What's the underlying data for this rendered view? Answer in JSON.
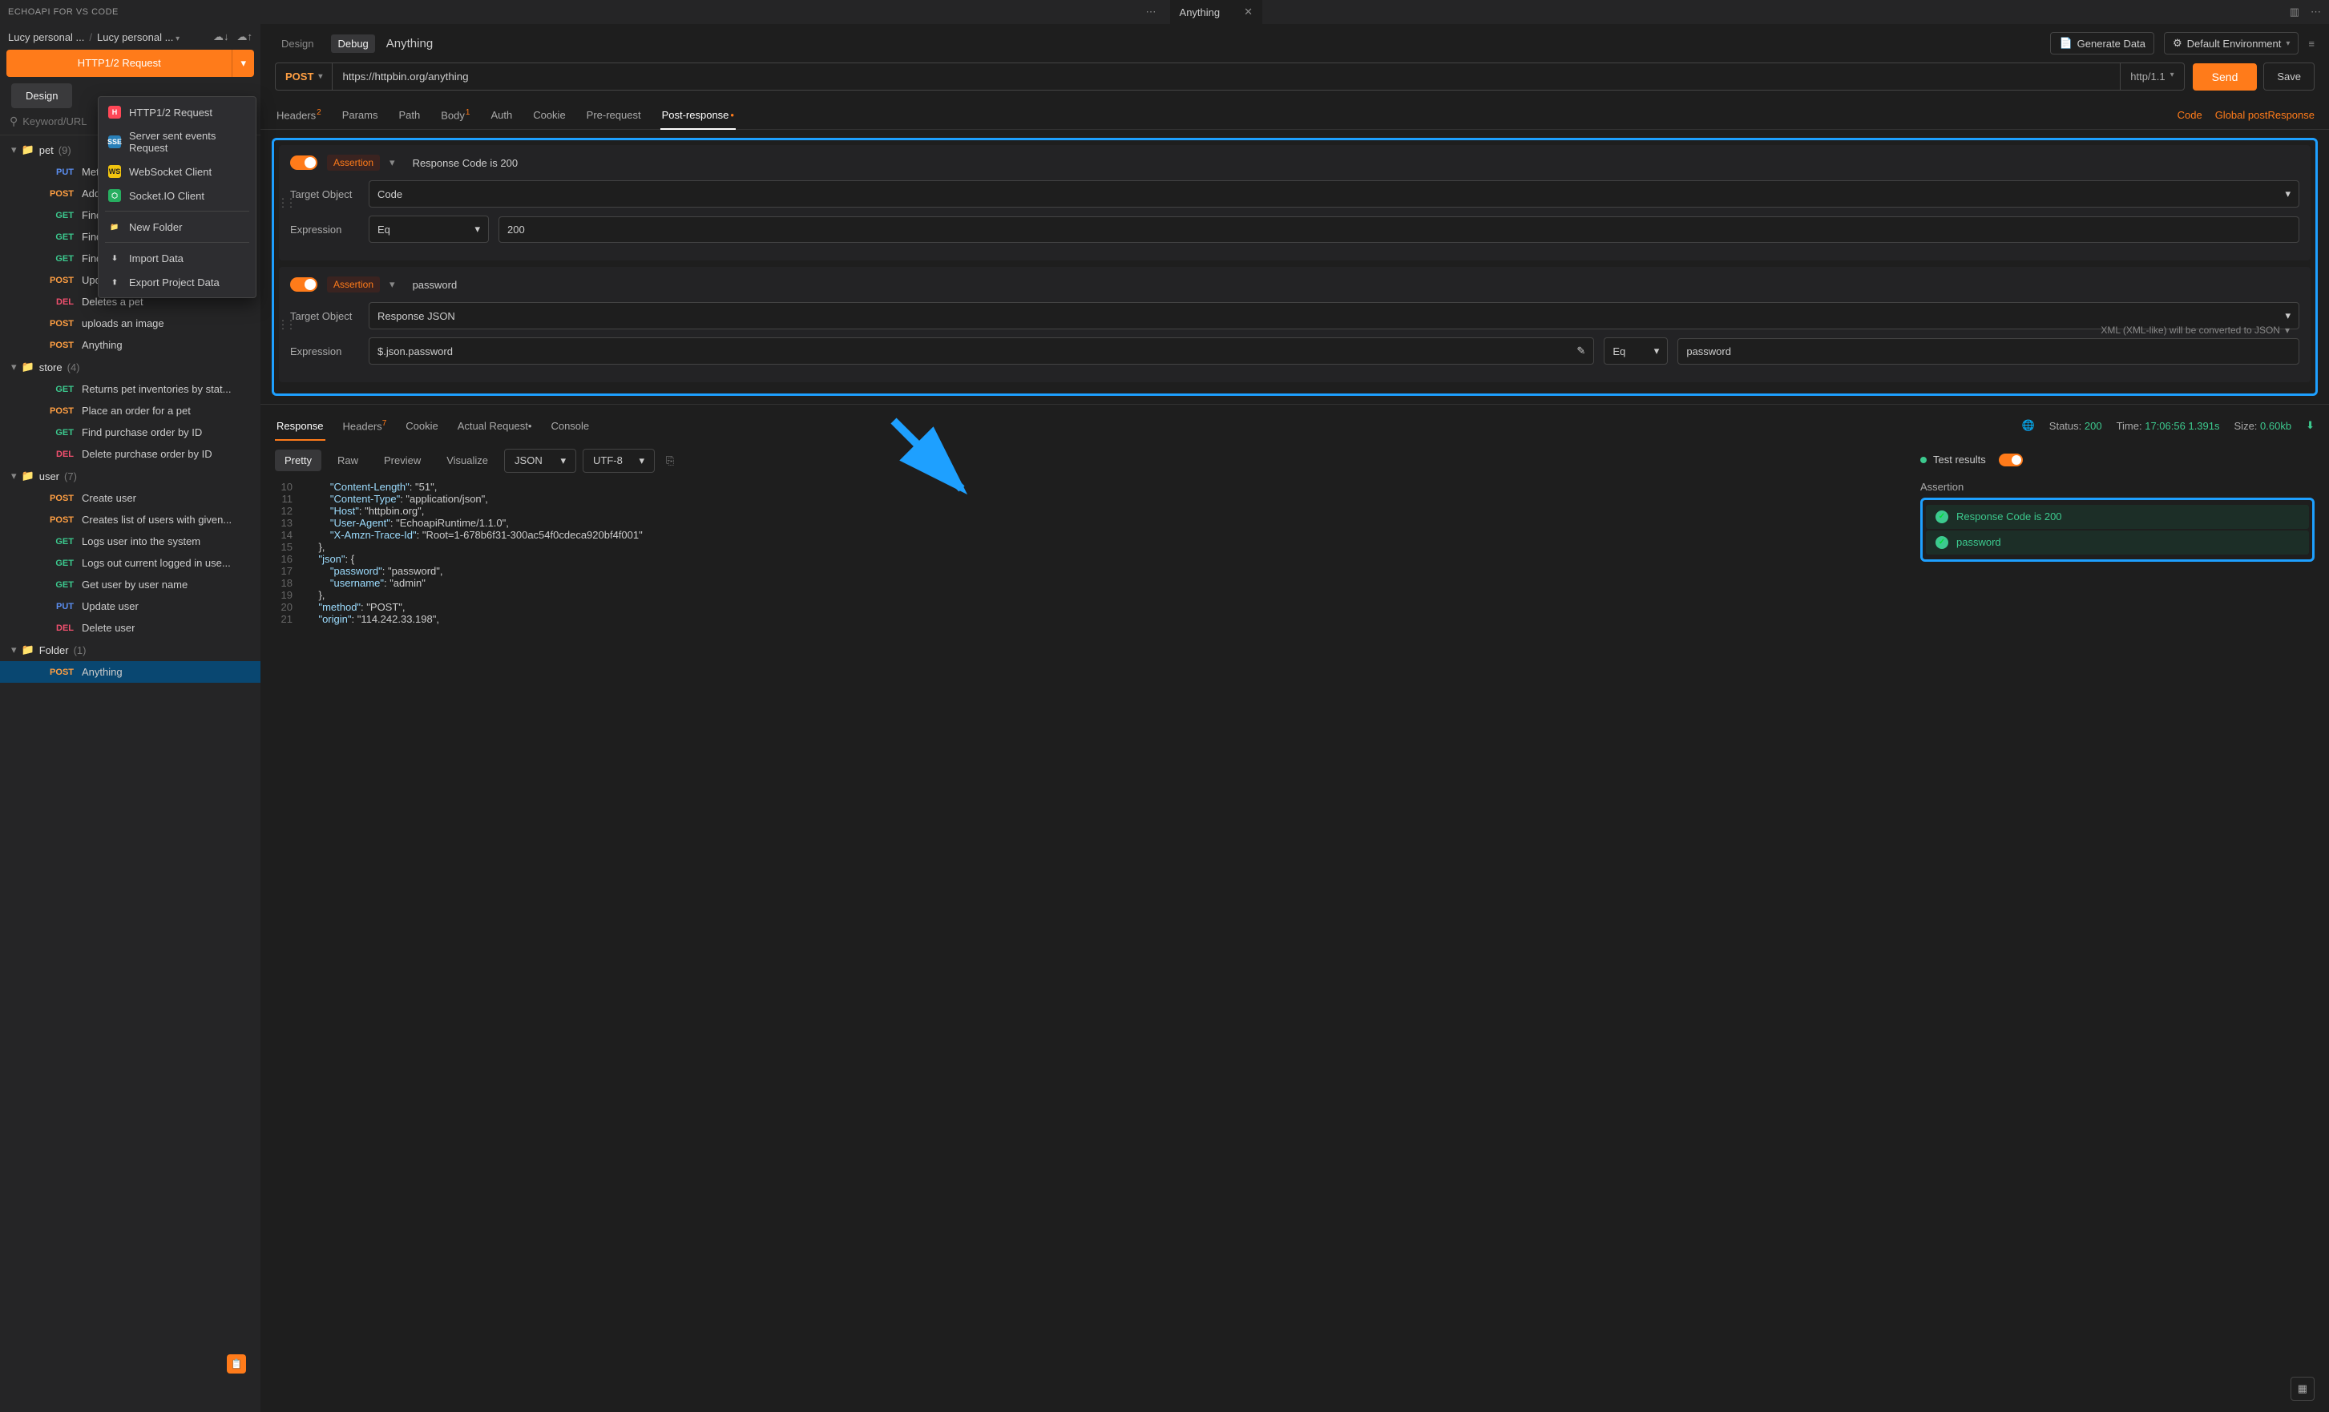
{
  "titlebar": {
    "ext_name": "ECHOAPI FOR VS CODE",
    "tab_title": "Anything"
  },
  "breadcrumb": {
    "crumb1": "Lucy personal ...",
    "crumb2": "Lucy personal ..."
  },
  "new_request_btn": "HTTP1/2 Request",
  "subtabs": {
    "design": "Design"
  },
  "search": {
    "placeholder": "Keyword/URL"
  },
  "dropdown": {
    "http": "HTTP1/2 Request",
    "sse": "Server sent events Request",
    "ws": "WebSocket Client",
    "sio": "Socket.IO Client",
    "newfolder": "New Folder",
    "import": "Import Data",
    "export": "Export Project Data"
  },
  "tree": {
    "pet": {
      "name": "pet",
      "count": "(9)"
    },
    "pet_items": [
      {
        "method": "PUT",
        "label": "Met"
      },
      {
        "method": "POST",
        "label": "Add"
      },
      {
        "method": "GET",
        "label": "Find"
      },
      {
        "method": "GET",
        "label": "Find"
      },
      {
        "method": "GET",
        "label": "Find pet by ID"
      },
      {
        "method": "POST",
        "label": "Updates a pet in the store with..."
      },
      {
        "method": "DEL",
        "label": "Deletes a pet"
      },
      {
        "method": "POST",
        "label": "uploads an image"
      },
      {
        "method": "POST",
        "label": "Anything"
      }
    ],
    "store": {
      "name": "store",
      "count": "(4)"
    },
    "store_items": [
      {
        "method": "GET",
        "label": "Returns pet inventories by stat..."
      },
      {
        "method": "POST",
        "label": "Place an order for a pet"
      },
      {
        "method": "GET",
        "label": "Find purchase order by ID"
      },
      {
        "method": "DEL",
        "label": "Delete purchase order by ID"
      }
    ],
    "user": {
      "name": "user",
      "count": "(7)"
    },
    "user_items": [
      {
        "method": "POST",
        "label": "Create user"
      },
      {
        "method": "POST",
        "label": "Creates list of users with given..."
      },
      {
        "method": "GET",
        "label": "Logs user into the system"
      },
      {
        "method": "GET",
        "label": "Logs out current logged in use..."
      },
      {
        "method": "GET",
        "label": "Get user by user name"
      },
      {
        "method": "PUT",
        "label": "Update user"
      },
      {
        "method": "DEL",
        "label": "Delete user"
      }
    ],
    "folder": {
      "name": "Folder",
      "count": "(1)"
    },
    "folder_items": [
      {
        "method": "POST",
        "label": "Anything"
      }
    ]
  },
  "toprow": {
    "design": "Design",
    "debug": "Debug",
    "name": "Anything",
    "generate": "Generate Data",
    "env": "Default Environment"
  },
  "url": {
    "method": "POST",
    "url": "https://httpbin.org/anything",
    "proto": "http/1.1",
    "send": "Send",
    "save": "Save"
  },
  "reqtabs": {
    "headers": "Headers",
    "headers_n": "2",
    "params": "Params",
    "path": "Path",
    "body": "Body",
    "body_n": "1",
    "auth": "Auth",
    "cookie": "Cookie",
    "prereq": "Pre-request",
    "postresp": "Post-response",
    "code": "Code",
    "global": "Global postResponse"
  },
  "assert1": {
    "chip": "Assertion",
    "title": "Response Code is 200",
    "target_lbl": "Target Object",
    "target_val": "Code",
    "expr_lbl": "Expression",
    "op": "Eq",
    "val": "200"
  },
  "assert2": {
    "chip": "Assertion",
    "title": "password",
    "target_lbl": "Target Object",
    "target_val": "Response JSON",
    "xml_note": "XML (XML-like) will be converted to JSON",
    "expr_lbl": "Expression",
    "path": "$.json.password",
    "op": "Eq",
    "val": "password"
  },
  "resptabs": {
    "response": "Response",
    "headers": "Headers",
    "headers_n": "7",
    "cookie": "Cookie",
    "actual": "Actual Request",
    "console": "Console"
  },
  "respmeta": {
    "status_lbl": "Status:",
    "status": "200",
    "time_lbl": "Time:",
    "time": "17:06:56",
    "dur": "1.391s",
    "size_lbl": "Size:",
    "size": "0.60kb"
  },
  "viewrow": {
    "pretty": "Pretty",
    "raw": "Raw",
    "preview": "Preview",
    "visualize": "Visualize",
    "fmt": "JSON",
    "enc": "UTF-8"
  },
  "code_lines": [
    {
      "n": "10",
      "t": "        \"Content-Length\": \"51\","
    },
    {
      "n": "11",
      "t": "        \"Content-Type\": \"application/json\","
    },
    {
      "n": "12",
      "t": "        \"Host\": \"httpbin.org\","
    },
    {
      "n": "13",
      "t": "        \"User-Agent\": \"EchoapiRuntime/1.1.0\","
    },
    {
      "n": "14",
      "t": "        \"X-Amzn-Trace-Id\": \"Root=1-678b6f31-300ac54f0cdeca920bf4f001\""
    },
    {
      "n": "15",
      "t": "    },"
    },
    {
      "n": "16",
      "t": "    \"json\": {"
    },
    {
      "n": "17",
      "t": "        \"password\": \"password\","
    },
    {
      "n": "18",
      "t": "        \"username\": \"admin\""
    },
    {
      "n": "19",
      "t": "    },"
    },
    {
      "n": "20",
      "t": "    \"method\": \"POST\","
    },
    {
      "n": "21",
      "t": "    \"origin\": \"114.242.33.198\","
    }
  ],
  "testresults": {
    "label": "Test results",
    "section": "Assertion",
    "r1": "Response Code is 200",
    "r2": "password"
  }
}
